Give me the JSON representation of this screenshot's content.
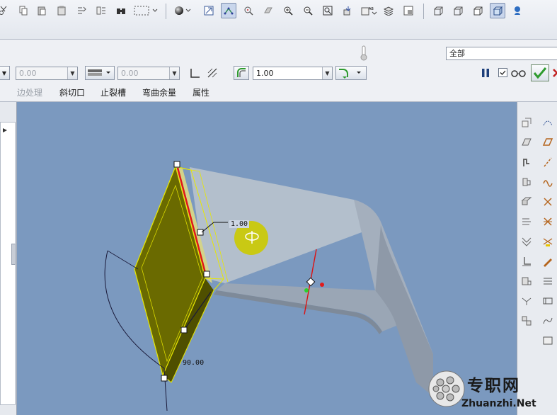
{
  "dashboard": {
    "combo_a_value": "0.00",
    "combo_b_value": "0.00",
    "thickness_value": "1.00",
    "filter_value": "全部"
  },
  "tabs": [
    {
      "label": "边处理",
      "enabled": false
    },
    {
      "label": "斜切口",
      "enabled": true
    },
    {
      "label": "止裂槽",
      "enabled": true
    },
    {
      "label": "弯曲余量",
      "enabled": true
    },
    {
      "label": "属性",
      "enabled": true
    }
  ],
  "viewport": {
    "dimension_label": "1.00",
    "angle_label": "90.00"
  },
  "watermark": {
    "text": "专职网",
    "url": "Zhuanzhi.Net"
  },
  "colors": {
    "accent_green": "#2e9b2e",
    "model_grey": "#b3bfcc",
    "flange_olive": "#6a6a00",
    "highlight_yellow": "#e8e800",
    "background_blue": "#7b99bf"
  }
}
